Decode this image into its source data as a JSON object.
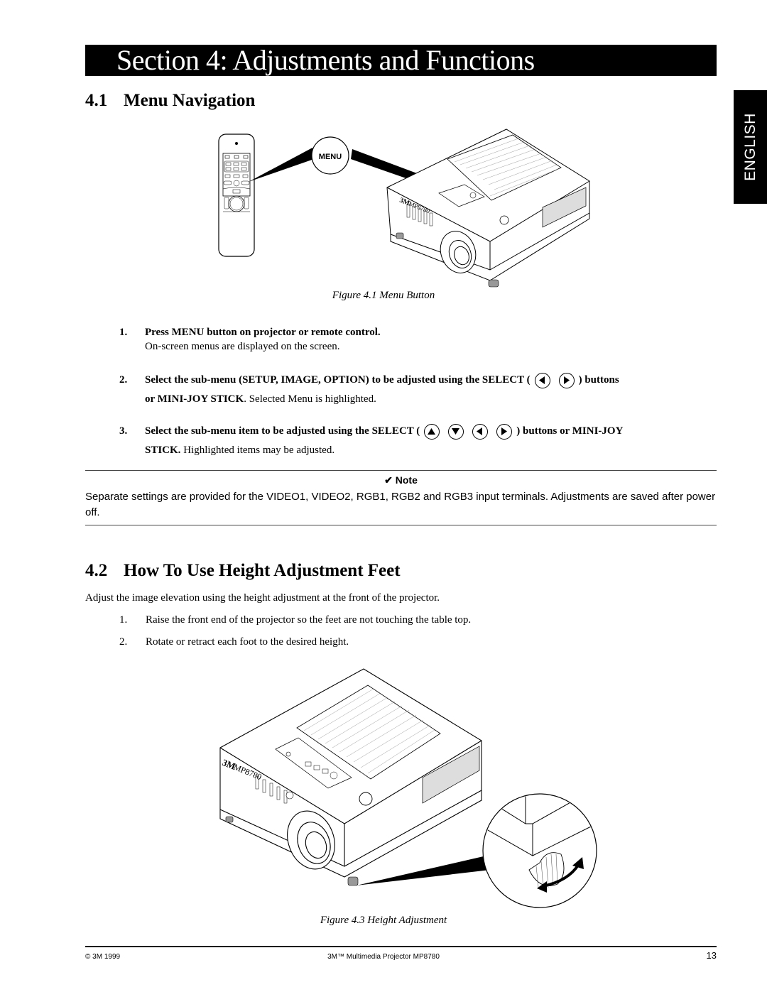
{
  "section": {
    "title": "Section 4: Adjustments and Functions",
    "language_tab": "ENGLISH"
  },
  "menu_navigation": {
    "number": "4.1",
    "heading": "Menu Navigation",
    "figure": {
      "button_callout": "MENU",
      "brand_label": "3M",
      "model_label": "MP8780",
      "caption": "Figure 4.1 Menu Button"
    },
    "steps": [
      {
        "number": "1.",
        "bold": "Press MENU button on projector or remote control.",
        "text": "On-screen menus are displayed on the screen."
      },
      {
        "number": "2.",
        "bold_prefix": "Select the sub-menu (SETUP, IMAGE, OPTION) to be adjusted using the SELECT (",
        "buttons": [
          "left-arrow",
          "right-arrow"
        ],
        "bold_suffix": ") buttons",
        "bold_line2": "or MINI-JOY STICK",
        "text": ". Selected Menu is highlighted."
      },
      {
        "number": "3.",
        "bold_prefix": "Select the sub-menu item to be adjusted using the SELECT (",
        "buttons": [
          "up-arrow",
          "down-arrow",
          "left-arrow",
          "right-arrow"
        ],
        "bold_suffix": ") buttons or MINI-JOY",
        "bold_line2": "STICK.",
        "text": " Highlighted items may be adjusted."
      }
    ]
  },
  "note": {
    "title": "✔ Note",
    "body": "Separate settings are provided for the VIDEO1, VIDEO2, RGB1, RGB2 and RGB3 input terminals.  Adjustments are saved after power off."
  },
  "height_adjustment": {
    "number": "4.2",
    "heading": "How To Use Height Adjustment Feet",
    "intro": "Adjust the image elevation using the height adjustment at the front of the projector.",
    "steps": [
      {
        "number": "1.",
        "text": "Raise the front end of the projector so the feet are not touching the table top."
      },
      {
        "number": "2.",
        "text": "Rotate or retract each foot to the desired height."
      }
    ],
    "figure": {
      "brand_label": "3M",
      "model_label": "MP8780",
      "caption": "Figure 4.3 Height Adjustment"
    }
  },
  "footer": {
    "copyright": "© 3M 1999",
    "product": "3M™ Multimedia Projector MP8780",
    "page_number": "13"
  }
}
